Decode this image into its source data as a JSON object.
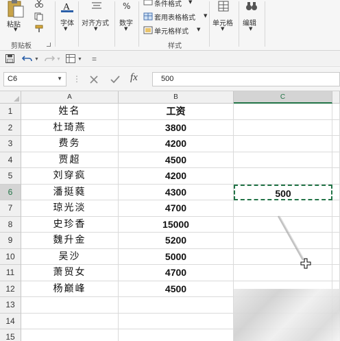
{
  "ribbon": {
    "clipboard": {
      "paste_label": "粘贴",
      "group_label": "剪贴板"
    },
    "font": {
      "label": "字体"
    },
    "alignment": {
      "label": "对齐方式"
    },
    "number": {
      "label": "数字",
      "symbol": "%"
    },
    "styles": {
      "conditional_format": "条件格式",
      "table_format": "套用表格格式",
      "cell_styles": "单元格样式",
      "group_label": "样式"
    },
    "cells": {
      "label": "单元格"
    },
    "editing": {
      "label": "编辑"
    }
  },
  "qat": {
    "more": "="
  },
  "formula_bar": {
    "name_box": "C6",
    "fx": "fx",
    "value": "500"
  },
  "sheet": {
    "columns": [
      "A",
      "B",
      "C"
    ],
    "selected_column": "C",
    "selected_row": "6",
    "rows": [
      {
        "num": "1",
        "a": "姓名",
        "b": "工资",
        "c": ""
      },
      {
        "num": "2",
        "a": "杜琦燕",
        "b": "3800",
        "c": ""
      },
      {
        "num": "3",
        "a": "费务",
        "b": "4200",
        "c": ""
      },
      {
        "num": "4",
        "a": "贾超",
        "b": "4500",
        "c": ""
      },
      {
        "num": "5",
        "a": "刘穿疯",
        "b": "4200",
        "c": ""
      },
      {
        "num": "6",
        "a": "潘挺蕤",
        "b": "4300",
        "c": "500"
      },
      {
        "num": "7",
        "a": "琼光淡",
        "b": "4700",
        "c": ""
      },
      {
        "num": "8",
        "a": "史珍香",
        "b": "15000",
        "c": ""
      },
      {
        "num": "9",
        "a": "魏升金",
        "b": "5200",
        "c": ""
      },
      {
        "num": "10",
        "a": "吴沙",
        "b": "5000",
        "c": ""
      },
      {
        "num": "11",
        "a": "萧贸女",
        "b": "4700",
        "c": ""
      },
      {
        "num": "12",
        "a": "杨巅峰",
        "b": "4500",
        "c": ""
      },
      {
        "num": "13",
        "a": "",
        "b": "",
        "c": ""
      },
      {
        "num": "14",
        "a": "",
        "b": "",
        "c": ""
      },
      {
        "num": "15",
        "a": "",
        "b": "",
        "c": ""
      }
    ]
  },
  "colors": {
    "accent": "#217346"
  }
}
